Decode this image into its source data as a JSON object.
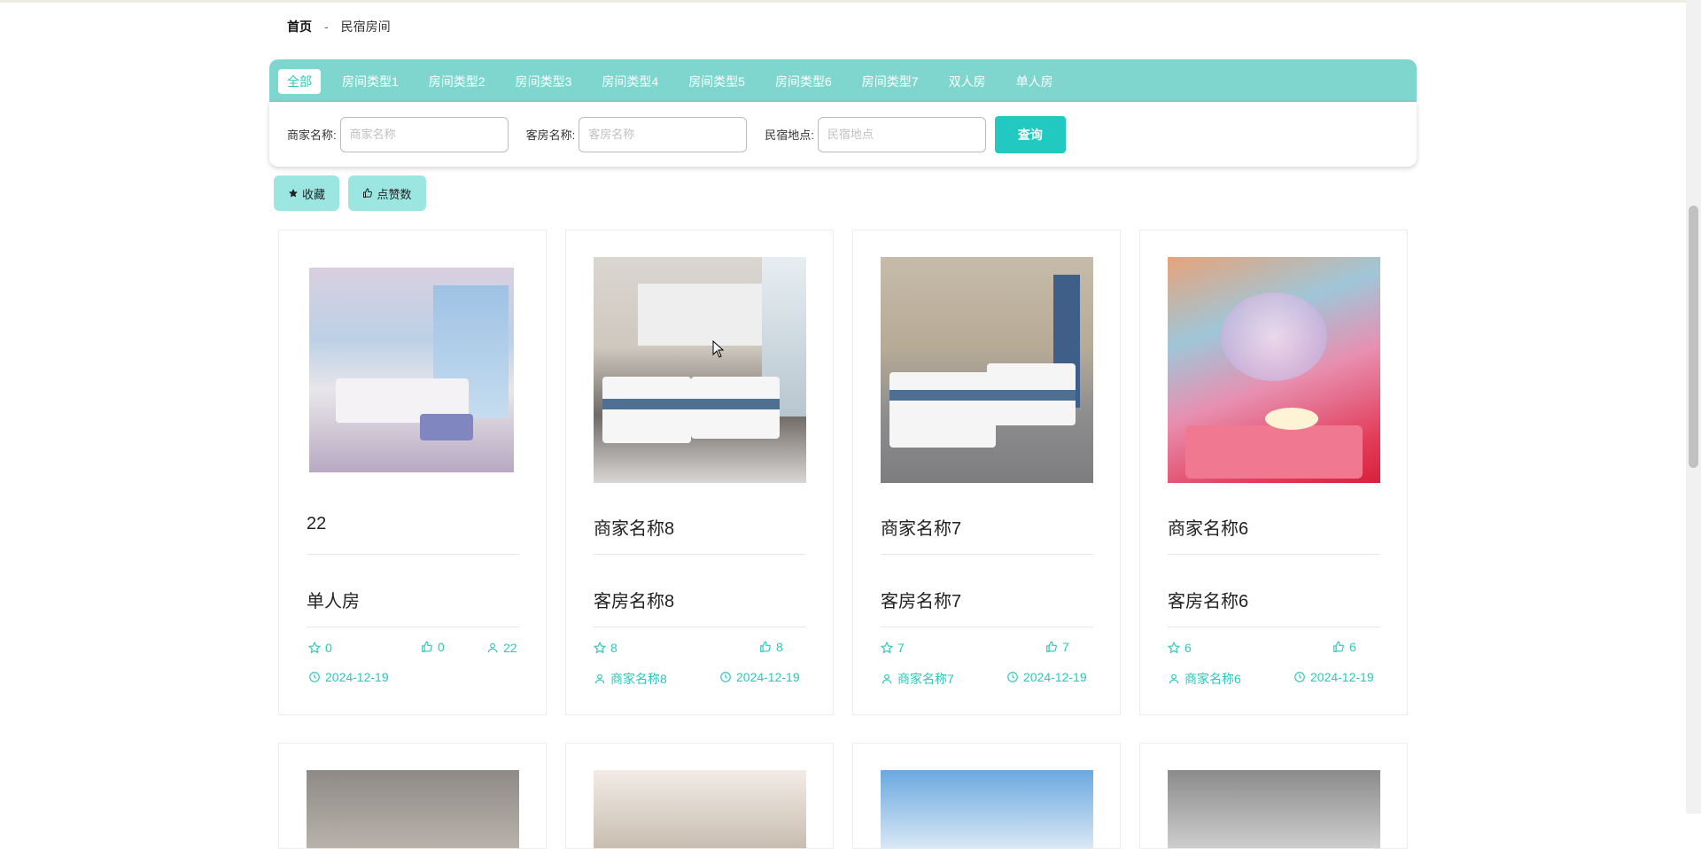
{
  "breadcrumb": {
    "home": "首页",
    "separator": "-",
    "current": "民宿房间"
  },
  "tabs": [
    {
      "label": "全部",
      "active": true
    },
    {
      "label": "房间类型1"
    },
    {
      "label": "房间类型2"
    },
    {
      "label": "房间类型3"
    },
    {
      "label": "房间类型4"
    },
    {
      "label": "房间类型5"
    },
    {
      "label": "房间类型6"
    },
    {
      "label": "房间类型7"
    },
    {
      "label": "双人房"
    },
    {
      "label": "单人房"
    }
  ],
  "filters": {
    "merchant_label": "商家名称:",
    "merchant_placeholder": "商家名称",
    "room_label": "客房名称:",
    "room_placeholder": "客房名称",
    "location_label": "民宿地点:",
    "location_placeholder": "民宿地点",
    "search_button": "查询"
  },
  "sort": {
    "favorite": "收藏",
    "likes": "点赞数"
  },
  "cards": [
    {
      "title": "22",
      "room": "单人房",
      "favorites": "0",
      "likes": "0",
      "views": "22",
      "date": "2024-12-19",
      "merchant": ""
    },
    {
      "title": "商家名称8",
      "room": "客房名称8",
      "favorites": "8",
      "likes": "8",
      "merchant": "商家名称8",
      "date": "2024-12-19"
    },
    {
      "title": "商家名称7",
      "room": "客房名称7",
      "favorites": "7",
      "likes": "7",
      "merchant": "商家名称7",
      "date": "2024-12-19"
    },
    {
      "title": "商家名称6",
      "room": "客房名称6",
      "favorites": "6",
      "likes": "6",
      "merchant": "商家名称6",
      "date": "2024-12-19"
    }
  ],
  "colors": {
    "accent": "#21c9c0",
    "tab_bar": "#7ed6cf",
    "sort_button": "#9ce6e2",
    "meta_text": "#2ec5bb"
  }
}
